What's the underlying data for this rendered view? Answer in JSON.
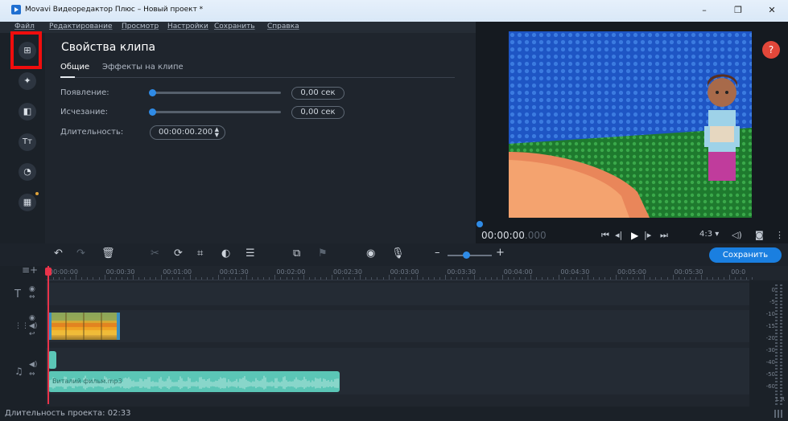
{
  "window": {
    "title": "Movavi Видеоредактор Плюс – Новый проект *",
    "minimize": "–",
    "maximize": "❐",
    "close": "✕"
  },
  "menu": [
    "Файл",
    "Редактирование",
    "Просмотр",
    "Настройки",
    "Сохранить",
    "Справка"
  ],
  "rail": [
    {
      "name": "import-icon",
      "glyph": "⊞"
    },
    {
      "name": "magic-wand-icon",
      "glyph": "✦"
    },
    {
      "name": "transitions-icon",
      "glyph": "◧"
    },
    {
      "name": "titles-icon",
      "glyph": "Tт"
    },
    {
      "name": "filters-icon",
      "glyph": "◔"
    },
    {
      "name": "more-tools-icon",
      "glyph": "▦"
    }
  ],
  "properties": {
    "title": "Свойства клипа",
    "tabs": [
      "Общие",
      "Эффекты на клипе"
    ],
    "fade_in_label": "Появление:",
    "fade_in_value": "0,00 сек",
    "fade_out_label": "Исчезание:",
    "fade_out_value": "0,00 сек",
    "duration_label": "Длительность:",
    "duration_value": "00:00:00.200"
  },
  "player": {
    "help": "?",
    "timecode": "00:00:00",
    "timecode_ms": ".000",
    "aspect": "4:3",
    "aspect_caret": "▾"
  },
  "toolbar": {
    "save_label": "Сохранить",
    "zoom_minus": "–",
    "zoom_plus": "+",
    "zoom_level": 0.35
  },
  "timeline": {
    "ruler": [
      "00:00:00",
      "00:00:30",
      "00:01:00",
      "00:01:30",
      "00:02:00",
      "00:02:30",
      "00:03:00",
      "00:03:30",
      "00:04:00",
      "00:04:30",
      "00:05:00",
      "00:05:30",
      "00:0"
    ],
    "audio_clip_name": "Виталий фильм.mp3",
    "vu_scale": [
      "0",
      "-5",
      "-10",
      "-15",
      "-20",
      "-30",
      "-40",
      "-50",
      "-60"
    ],
    "vu_lr": "L R"
  },
  "status": {
    "duration_text": "Длительность проекта: 02:33"
  },
  "colors": {
    "accent": "#1a7fe0",
    "highlight": "#f10d0d",
    "audio": "#5bc6b6",
    "playhead": "#e8334a"
  }
}
